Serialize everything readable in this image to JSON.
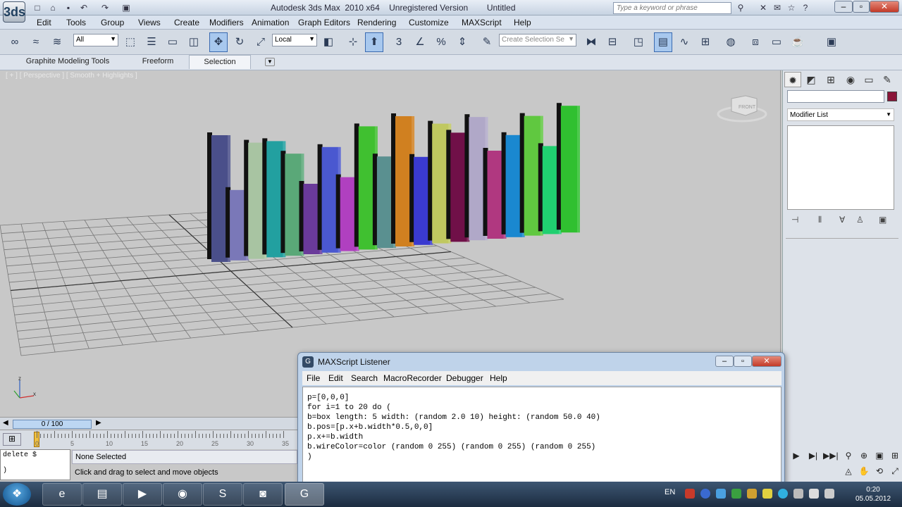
{
  "window": {
    "title": "Autodesk 3ds Max  2010 x64    Unregistered Version        Untitled",
    "search_placeholder": "Type a keyword or phrase",
    "app_logo": "3ds"
  },
  "menu": [
    "Edit",
    "Tools",
    "Group",
    "Views",
    "Create",
    "Modifiers",
    "Animation",
    "Graph Editors",
    "Rendering",
    "Customize",
    "MAXScript",
    "Help"
  ],
  "toolbar": {
    "selection_filter": "All",
    "ref_coord": "Local",
    "snap_number": "3",
    "named_selection_placeholder": "Create Selection Se"
  },
  "ribbon": {
    "tabs": [
      "Graphite Modeling Tools",
      "Freeform",
      "Selection"
    ],
    "selected": "Selection"
  },
  "viewport": {
    "label": "[ + ] [ Perspective ] [ Smooth + Highlights ]",
    "viewcube_face": "FRONT",
    "axis": {
      "x": "x",
      "z": "z"
    }
  },
  "command_panel": {
    "modifier_list": "Modifier List",
    "object_color": "#8a1538"
  },
  "timeline": {
    "slider_label": "0 / 100",
    "ticks": [
      "0",
      "5",
      "10",
      "15",
      "20",
      "25",
      "30",
      "35"
    ]
  },
  "status": {
    "mini_listener_cmd": "delete $",
    "mini_listener_out": ")",
    "selection": "None Selected",
    "prompt": "Click and drag to select and move objects"
  },
  "listener": {
    "title": "MAXScript Listener",
    "menu": [
      "File",
      "Edit",
      "Search",
      "MacroRecorder",
      "Debugger",
      "Help"
    ],
    "code": "p=[0,0,0]\nfor i=1 to 20 do (\nb=box length: 5 width: (random 2.0 10) height: (random 50.0 40)\nb.pos=[p.x+b.width*0.5,0,0]\np.x+=b.width\nb.wireColor=color (random 0 255) (random 0 255) (random 0 255)\n)"
  },
  "taskbar": {
    "language": "EN",
    "time": "0:20",
    "date": "05.05.2012"
  },
  "boxes": [
    {
      "c": "#4a4f8a",
      "h": 180
    },
    {
      "c": "#7a78b8",
      "h": 100
    },
    {
      "c": "#a8c4a2",
      "h": 165
    },
    {
      "c": "#22a0a0",
      "h": 165
    },
    {
      "c": "#5aa878",
      "h": 145
    },
    {
      "c": "#6a3a9a",
      "h": 100
    },
    {
      "c": "#4a58d0",
      "h": 150
    },
    {
      "c": "#b040c0",
      "h": 105
    },
    {
      "c": "#40c030",
      "h": 175
    },
    {
      "c": "#5a9090",
      "h": 130
    },
    {
      "c": "#d08020",
      "h": 185
    },
    {
      "c": "#3a3ad0",
      "h": 125
    },
    {
      "c": "#c0c860",
      "h": 170
    },
    {
      "c": "#701048",
      "h": 155
    },
    {
      "c": "#b0a8c8",
      "h": 175
    },
    {
      "c": "#b03880",
      "h": 125
    },
    {
      "c": "#1a88d0",
      "h": 145
    },
    {
      "c": "#60c840",
      "h": 170
    },
    {
      "c": "#20d070",
      "h": 125
    },
    {
      "c": "#30c030",
      "h": 180
    }
  ]
}
